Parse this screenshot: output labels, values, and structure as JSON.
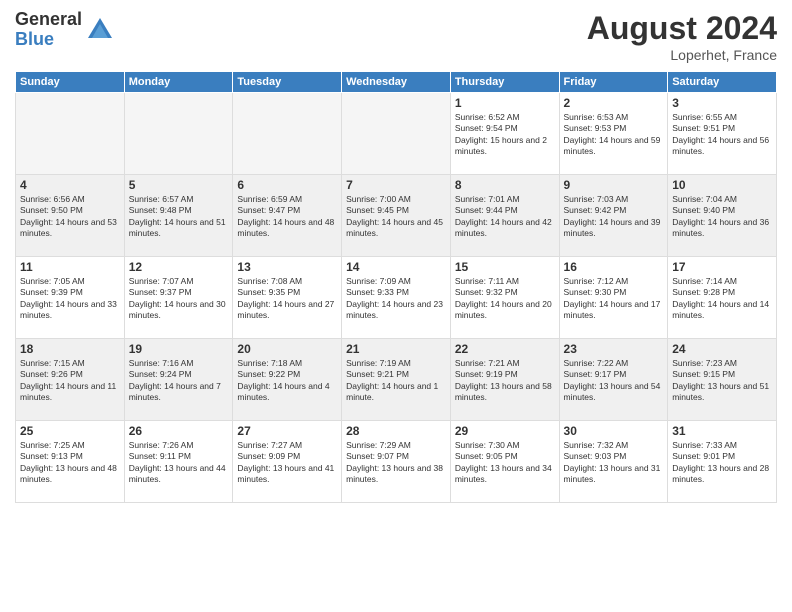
{
  "logo": {
    "general": "General",
    "blue": "Blue"
  },
  "title": "August 2024",
  "location": "Loperhet, France",
  "days_of_week": [
    "Sunday",
    "Monday",
    "Tuesday",
    "Wednesday",
    "Thursday",
    "Friday",
    "Saturday"
  ],
  "weeks": [
    [
      {
        "day": "",
        "info": ""
      },
      {
        "day": "",
        "info": ""
      },
      {
        "day": "",
        "info": ""
      },
      {
        "day": "",
        "info": ""
      },
      {
        "day": "1",
        "info": "Sunrise: 6:52 AM\nSunset: 9:54 PM\nDaylight: 15 hours and 2 minutes."
      },
      {
        "day": "2",
        "info": "Sunrise: 6:53 AM\nSunset: 9:53 PM\nDaylight: 14 hours and 59 minutes."
      },
      {
        "day": "3",
        "info": "Sunrise: 6:55 AM\nSunset: 9:51 PM\nDaylight: 14 hours and 56 minutes."
      }
    ],
    [
      {
        "day": "4",
        "info": "Sunrise: 6:56 AM\nSunset: 9:50 PM\nDaylight: 14 hours and 53 minutes."
      },
      {
        "day": "5",
        "info": "Sunrise: 6:57 AM\nSunset: 9:48 PM\nDaylight: 14 hours and 51 minutes."
      },
      {
        "day": "6",
        "info": "Sunrise: 6:59 AM\nSunset: 9:47 PM\nDaylight: 14 hours and 48 minutes."
      },
      {
        "day": "7",
        "info": "Sunrise: 7:00 AM\nSunset: 9:45 PM\nDaylight: 14 hours and 45 minutes."
      },
      {
        "day": "8",
        "info": "Sunrise: 7:01 AM\nSunset: 9:44 PM\nDaylight: 14 hours and 42 minutes."
      },
      {
        "day": "9",
        "info": "Sunrise: 7:03 AM\nSunset: 9:42 PM\nDaylight: 14 hours and 39 minutes."
      },
      {
        "day": "10",
        "info": "Sunrise: 7:04 AM\nSunset: 9:40 PM\nDaylight: 14 hours and 36 minutes."
      }
    ],
    [
      {
        "day": "11",
        "info": "Sunrise: 7:05 AM\nSunset: 9:39 PM\nDaylight: 14 hours and 33 minutes."
      },
      {
        "day": "12",
        "info": "Sunrise: 7:07 AM\nSunset: 9:37 PM\nDaylight: 14 hours and 30 minutes."
      },
      {
        "day": "13",
        "info": "Sunrise: 7:08 AM\nSunset: 9:35 PM\nDaylight: 14 hours and 27 minutes."
      },
      {
        "day": "14",
        "info": "Sunrise: 7:09 AM\nSunset: 9:33 PM\nDaylight: 14 hours and 23 minutes."
      },
      {
        "day": "15",
        "info": "Sunrise: 7:11 AM\nSunset: 9:32 PM\nDaylight: 14 hours and 20 minutes."
      },
      {
        "day": "16",
        "info": "Sunrise: 7:12 AM\nSunset: 9:30 PM\nDaylight: 14 hours and 17 minutes."
      },
      {
        "day": "17",
        "info": "Sunrise: 7:14 AM\nSunset: 9:28 PM\nDaylight: 14 hours and 14 minutes."
      }
    ],
    [
      {
        "day": "18",
        "info": "Sunrise: 7:15 AM\nSunset: 9:26 PM\nDaylight: 14 hours and 11 minutes."
      },
      {
        "day": "19",
        "info": "Sunrise: 7:16 AM\nSunset: 9:24 PM\nDaylight: 14 hours and 7 minutes."
      },
      {
        "day": "20",
        "info": "Sunrise: 7:18 AM\nSunset: 9:22 PM\nDaylight: 14 hours and 4 minutes."
      },
      {
        "day": "21",
        "info": "Sunrise: 7:19 AM\nSunset: 9:21 PM\nDaylight: 14 hours and 1 minute."
      },
      {
        "day": "22",
        "info": "Sunrise: 7:21 AM\nSunset: 9:19 PM\nDaylight: 13 hours and 58 minutes."
      },
      {
        "day": "23",
        "info": "Sunrise: 7:22 AM\nSunset: 9:17 PM\nDaylight: 13 hours and 54 minutes."
      },
      {
        "day": "24",
        "info": "Sunrise: 7:23 AM\nSunset: 9:15 PM\nDaylight: 13 hours and 51 minutes."
      }
    ],
    [
      {
        "day": "25",
        "info": "Sunrise: 7:25 AM\nSunset: 9:13 PM\nDaylight: 13 hours and 48 minutes."
      },
      {
        "day": "26",
        "info": "Sunrise: 7:26 AM\nSunset: 9:11 PM\nDaylight: 13 hours and 44 minutes."
      },
      {
        "day": "27",
        "info": "Sunrise: 7:27 AM\nSunset: 9:09 PM\nDaylight: 13 hours and 41 minutes."
      },
      {
        "day": "28",
        "info": "Sunrise: 7:29 AM\nSunset: 9:07 PM\nDaylight: 13 hours and 38 minutes."
      },
      {
        "day": "29",
        "info": "Sunrise: 7:30 AM\nSunset: 9:05 PM\nDaylight: 13 hours and 34 minutes."
      },
      {
        "day": "30",
        "info": "Sunrise: 7:32 AM\nSunset: 9:03 PM\nDaylight: 13 hours and 31 minutes."
      },
      {
        "day": "31",
        "info": "Sunrise: 7:33 AM\nSunset: 9:01 PM\nDaylight: 13 hours and 28 minutes."
      }
    ]
  ]
}
